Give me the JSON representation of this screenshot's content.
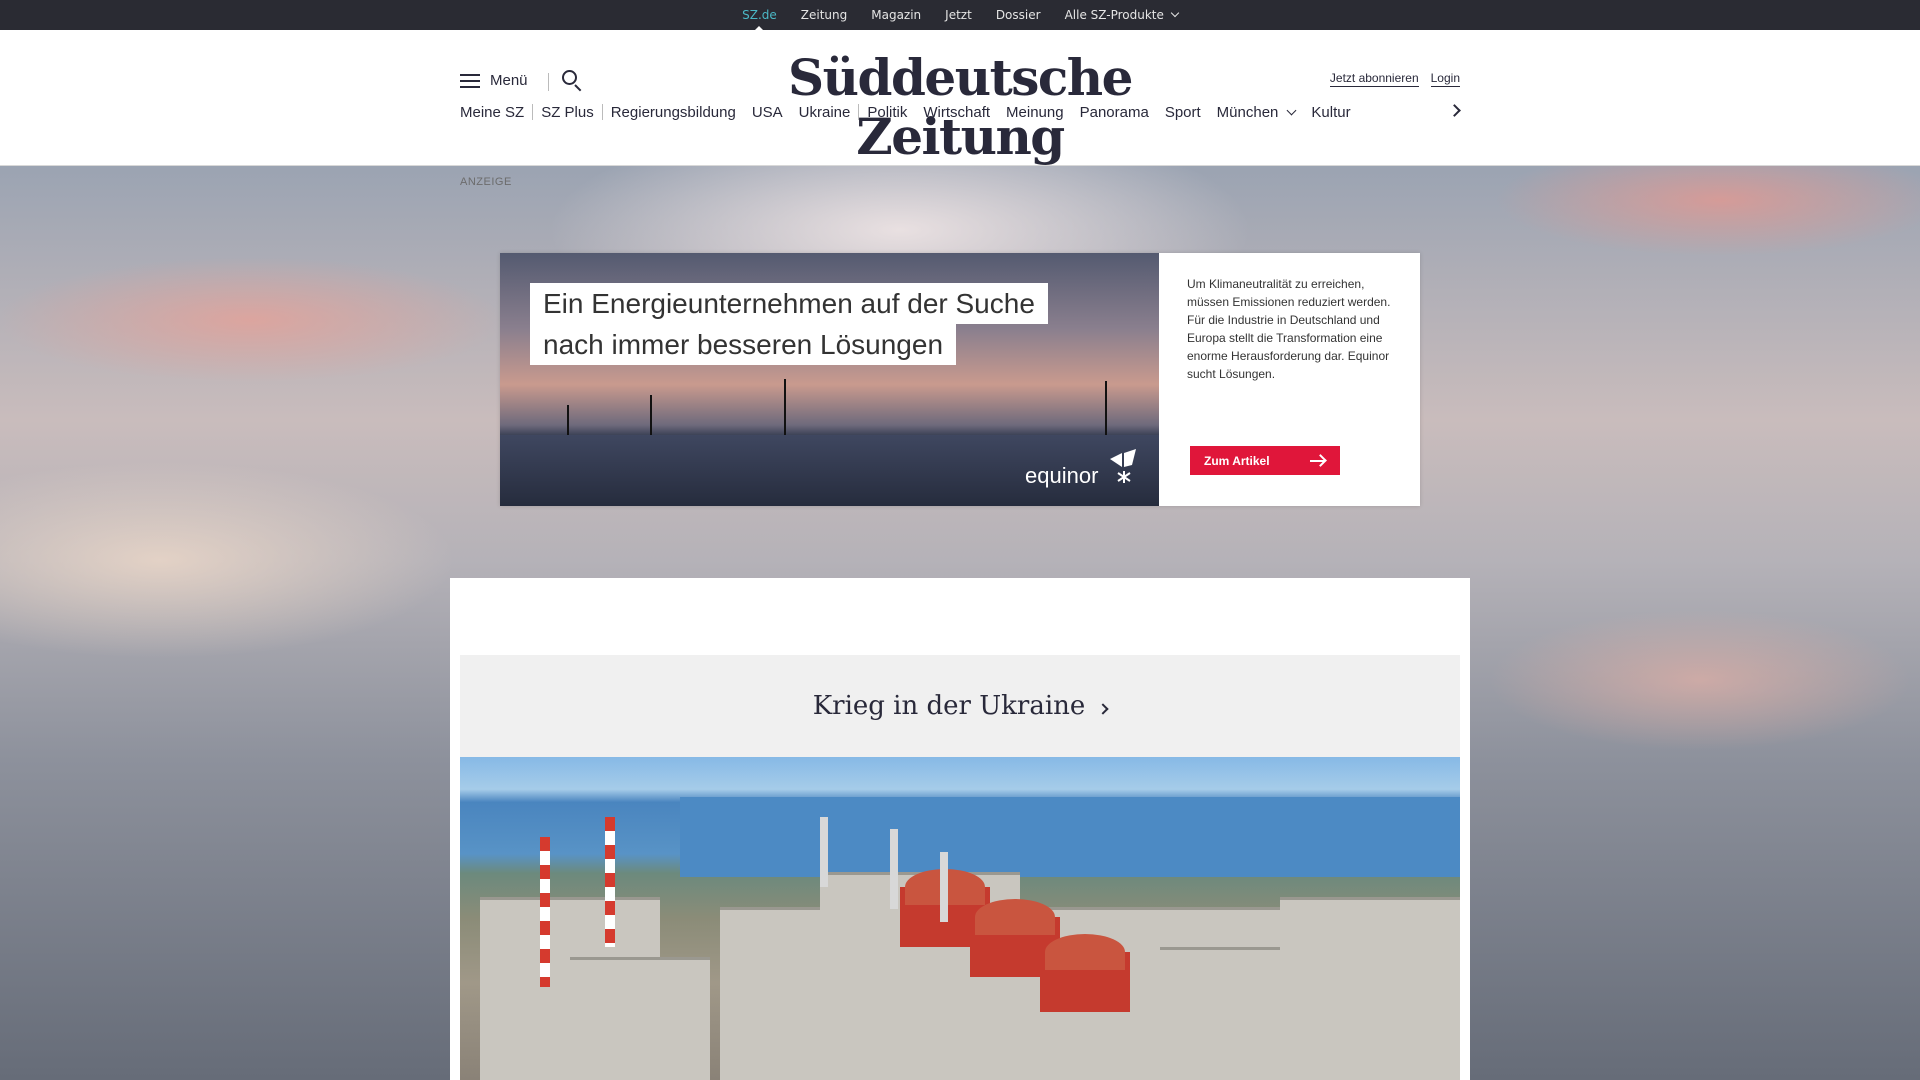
{
  "topbar": {
    "links": [
      {
        "label": "SZ.de",
        "active": true
      },
      {
        "label": "Zeitung",
        "active": false
      },
      {
        "label": "Magazin",
        "active": false
      },
      {
        "label": "Jetzt",
        "active": false
      },
      {
        "label": "Dossier",
        "active": false
      },
      {
        "label": "Alle SZ-Produkte",
        "active": false,
        "dropdown": true
      }
    ]
  },
  "header": {
    "menu_label": "Menü",
    "logo": "Süddeutsche Zeitung",
    "subscribe_label": "Jetzt abonnieren",
    "login_label": "Login"
  },
  "nav": {
    "items": [
      "Meine SZ",
      "SZ Plus",
      "Regierungsbildung",
      "USA",
      "Ukraine",
      "Politik",
      "Wirtschaft",
      "Meinung",
      "Panorama",
      "Sport",
      "München",
      "Kultur"
    ]
  },
  "ad": {
    "label": "ANZEIGE",
    "headline_line1": "Ein Energieunternehmen auf der Suche",
    "headline_line2": "nach immer besseren Lösungen",
    "brand": "equinor",
    "text": "Um Klimaneutralität zu erreichen, müssen Emissionen reduziert werden. Für die Industrie in Deutschland und Europa stellt die Transformation eine enorme Herausforderung dar. Equinor sucht Lösungen.",
    "cta_label": "Zum Artikel"
  },
  "section": {
    "title": "Krieg in der Ukraine"
  },
  "colors": {
    "topbar_bg": "#2a2b33",
    "active_link": "#4bb8c6",
    "text": "#29293a",
    "cta": "#e0163a",
    "section_bg": "#f0f0f0"
  }
}
